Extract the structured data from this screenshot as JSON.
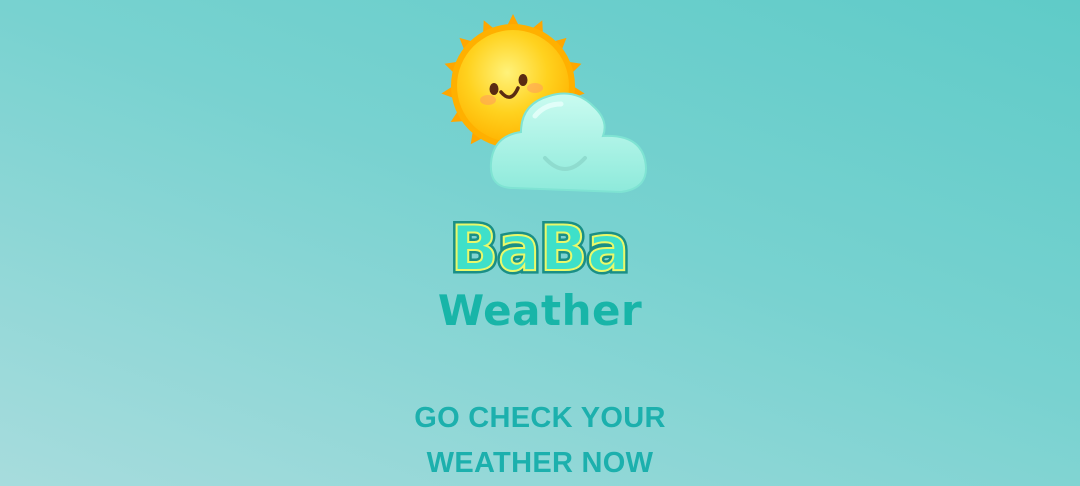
{
  "app": {
    "logo_icon": "sun-behind-cloud-icon",
    "name_line1": "BaBa",
    "name_line2": "Weather"
  },
  "cta": {
    "line1": "GO CHECK YOUR",
    "line2": "WEATHER NOW"
  },
  "colors": {
    "background_top": "#5fcbc8",
    "background_bottom": "#a7dcdd",
    "brand_teal": "#18b5a8",
    "brand_fill": "#3ee0c9",
    "brand_outline": "#1a8f86",
    "brand_glow": "#e9f96a",
    "sun_yellow": "#ffd21f",
    "sun_orange": "#ff9f00",
    "cloud": "#aef3e6"
  }
}
